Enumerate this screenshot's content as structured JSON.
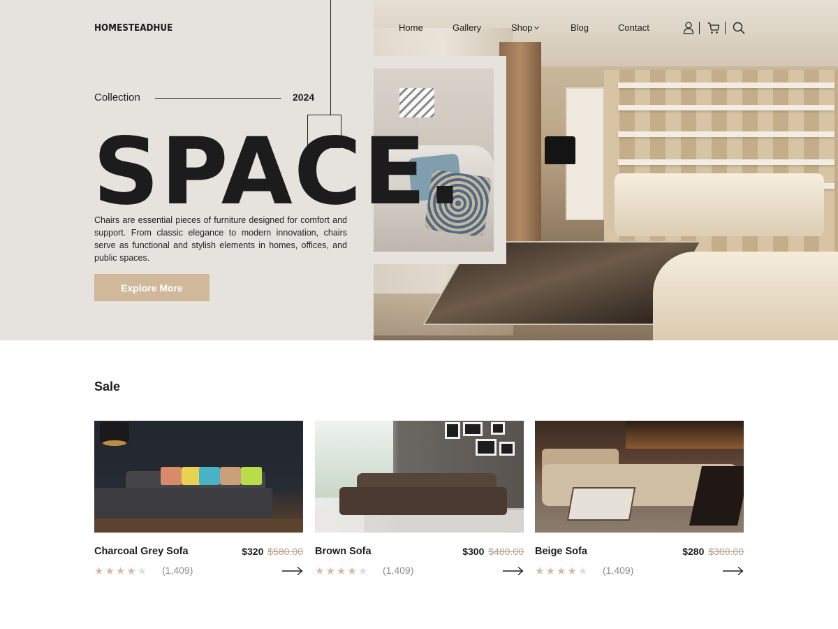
{
  "brand": "HOMESTEADHUE",
  "nav": {
    "items": [
      "Home",
      "Gallery",
      "Shop",
      "Blog",
      "Contact"
    ],
    "icons": [
      "user-icon",
      "cart-icon",
      "search-icon"
    ]
  },
  "hero": {
    "collection_label": "Collection",
    "year": "2024",
    "headline": "SPACE.",
    "description": "Chairs are essential pieces of furniture designed for comfort and support. From classic elegance to modern innovation, chairs serve as functional and stylish elements in homes, offices, and public spaces.",
    "cta": "Explore More"
  },
  "sale": {
    "title": "Sale",
    "products": [
      {
        "name": "Charcoal Grey Sofa",
        "price": "$320",
        "old_price": "$580.00",
        "rating": 4,
        "reviews": "(1,409)"
      },
      {
        "name": "Brown Sofa",
        "price": "$300",
        "old_price": "$480.00",
        "rating": 4,
        "reviews": "(1,409)"
      },
      {
        "name": "Beige Sofa",
        "price": "$280",
        "old_price": "$300.00",
        "rating": 4,
        "reviews": "(1,409)"
      }
    ]
  },
  "colors": {
    "hero_bg": "#e6e2de",
    "accent": "#d1b89b",
    "strike_price": "#b79f89",
    "star": "#d3bba0",
    "text": "#1d1d1d"
  }
}
